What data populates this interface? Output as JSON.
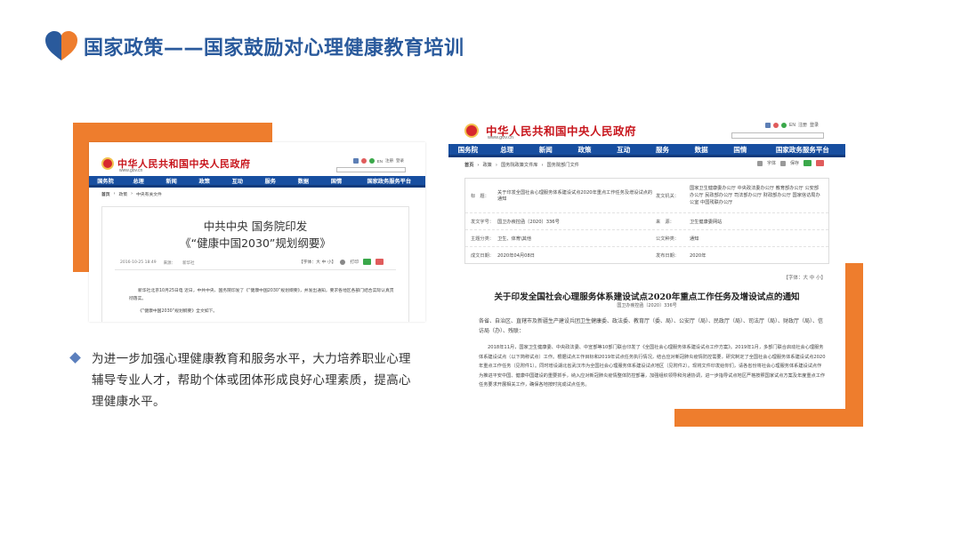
{
  "slide": {
    "title": "国家政策——国家鼓励对心理健康教育培训",
    "bullet": "为进一步加强心理健康教育和服务水平，大力培养职业心理辅导专业人才，帮助个体或团体形成良好心理素质，提高心理健康水平。"
  },
  "colors": {
    "accent_orange": "#ee7d2d",
    "title_blue": "#2a5a9c",
    "nav_blue": "#174ea0",
    "gov_red": "#c8161d"
  },
  "gov_site": {
    "name": "中华人民共和国中央人民政府",
    "url": "www.gov.cn",
    "top_links": [
      "EN",
      "注册",
      "登录"
    ],
    "nav": [
      "国务院",
      "总理",
      "新闻",
      "政策",
      "互动",
      "服务",
      "数据",
      "国情",
      "国家政务服务平台"
    ]
  },
  "left_shot": {
    "breadcrumb": [
      "首页",
      "政策",
      "中央有关文件"
    ],
    "title_line1": "中共中央 国务院印发",
    "title_line2": "《“健康中国2030”规划纲要》",
    "meta_date": "2016-10-25 18:49",
    "meta_source": "来源：",
    "meta_publisher": "新华社",
    "font_tool": "【字体：大 中 小】",
    "print_tool": "打印",
    "body_para1": "新华社北京10月25日电 近日，中共中央、国务院印发了《“健康中国2030”规划纲要》，并发出通知，要求各地区各部门结合实际认真贯彻落实。",
    "body_para2": "《“健康中国2030”规划纲要》全文如下。"
  },
  "right_shot": {
    "breadcrumb": [
      "首页",
      "政策",
      "国务院政策文件库",
      "国务院部门文件"
    ],
    "crumb_font": "字体",
    "crumb_save": "保存",
    "table": {
      "title_label": "标　题：",
      "title_value": "关于印发全国社会心理服务体系建设试点2020年重点工作任务及增设试点的通知",
      "org_label": "发文机关：",
      "org_value": "国家卫生健康委办公厅 中央政法委办公厅 教育部办公厅 公安部办公厅 民政部办公厅 司法部办公厅 财政部办公厅 国家信访局办公室 中国残联办公厅",
      "docno_label": "发文字号：",
      "docno_value": "国卫办疾控函〔2020〕336号",
      "source_label": "来　源：",
      "source_value": "卫生健康委网站",
      "topic_label": "主题分类：",
      "topic_value": "卫生、体育\\其他",
      "genre_label": "公文种类：",
      "genre_value": "通知",
      "write_label": "成文日期：",
      "write_value": "2020年04月08日",
      "pub_label": "发布日期：",
      "pub_value": "2020年"
    },
    "font_tool": "【字体：大 中 小】",
    "notice_title": "关于印发全国社会心理服务体系建设试点2020年重点工作任务及增设试点的通知",
    "doc_number": "国卫办疾控函〔2020〕336号",
    "recipients": "各省、自治区、直辖市及新疆生产建设兵团卫生健康委、政法委、教育厅（委、局）、公安厅（局）、民政厅（局）、司法厅（局）、财政厅（局）、信访局（办）、残联：",
    "body": "2018年11月，国家卫生健康委、中央政法委、中宣部等10部门联合印发了《全国社会心理服务体系建设试点工作方案》。2019年1月，多部门联合启动社会心理服务体系建设试点（以下简称试点）工作。根据试点工作目标和2019年试点任务执行情况，结合应对新冠肺炎疫情防控需要，研究制定了全国社会心理服务体系建设试点2020年重点工作任务（见附件1）。同时增设湖北省武汉市为全国社会心理服务体系建设试点地区（见附件2）。现将文件印发给你们，请各省份将社会心理服务体系建设试点作为推进平安中国、健康中国建设的重要抓手，纳入应对新冠肺炎疫情整体防控部署，加强组织领导和沟通协调，进一步指导试点地区严格按照国家试点方案及年度重点工作任务要求开展相关工作，确保各地按时完成试点任务。"
  }
}
